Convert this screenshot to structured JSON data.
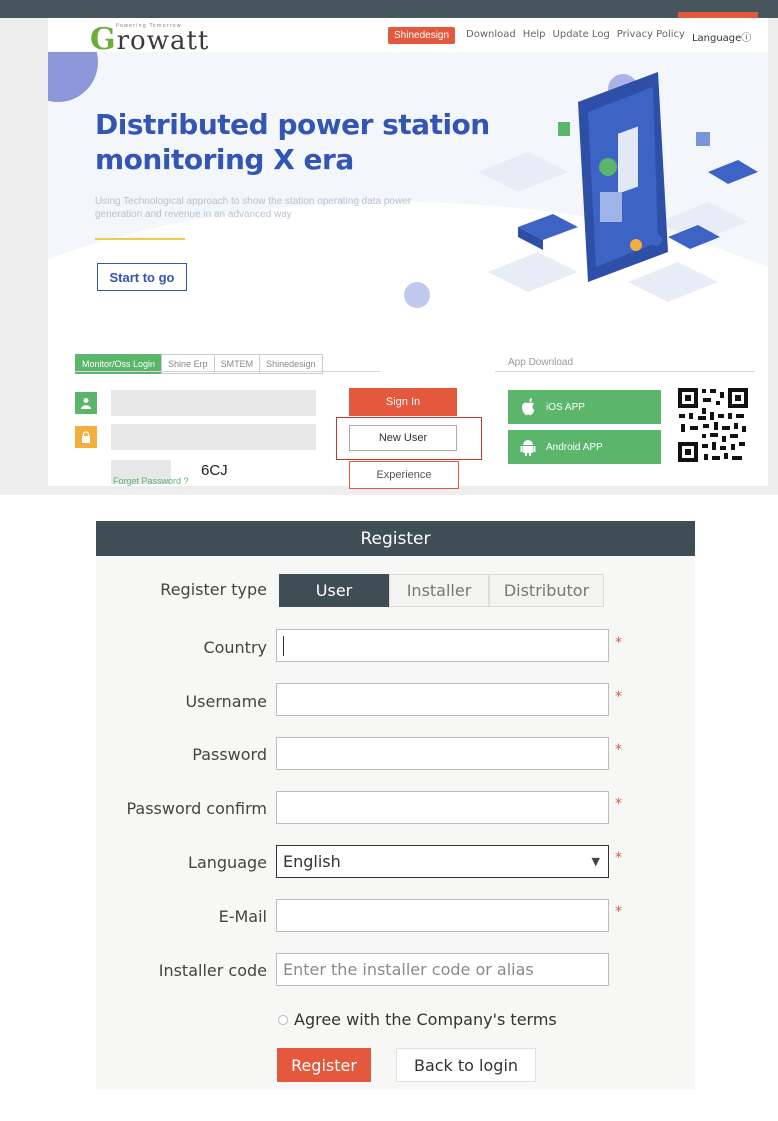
{
  "header": {
    "logo_text": "rowatt",
    "logo_letter": "G",
    "logo_tagline": "Powering Tomorrow",
    "badge": "Shinedesign",
    "links": [
      "Download",
      "Help",
      "Update Log",
      "Privacy Policy"
    ],
    "language": "Languageⓘ"
  },
  "hero": {
    "title": "Distributed power station monitoring X era",
    "subtitle": "Using Technological approach to show the station operating data power generation and revenue in an advanced way",
    "start_button": "Start to go"
  },
  "login": {
    "tabs": [
      "Monitor/Oss Login",
      "Shine Erp",
      "SMTEM",
      "Shinedesign"
    ],
    "active_tab": 0,
    "captcha": "6CJ",
    "forget_password": "Forget Password ?",
    "sign_in": "Sign In",
    "new_user": "New User",
    "experience": "Experience"
  },
  "app_download": {
    "title": "App Download",
    "ios": "iOS APP",
    "android": "Android APP"
  },
  "register": {
    "title": "Register",
    "type_label": "Register type",
    "types": [
      "User",
      "Installer",
      "Distributor"
    ],
    "active_type": 0,
    "fields": {
      "country": {
        "label": "Country",
        "value": ""
      },
      "username": {
        "label": "Username",
        "value": ""
      },
      "password": {
        "label": "Password",
        "value": ""
      },
      "password_confirm": {
        "label": "Password confirm",
        "value": ""
      },
      "language": {
        "label": "Language",
        "value": "English"
      },
      "email": {
        "label": "E-Mail",
        "value": ""
      },
      "installer_code": {
        "label": "Installer code",
        "placeholder": "Enter the installer code or alias"
      }
    },
    "required_mark": "*",
    "agree": "Agree with the Company's terms",
    "register_button": "Register",
    "back_button": "Back to login"
  },
  "colors": {
    "primary_green": "#5bb56b",
    "accent_red": "#e4583d",
    "dark_header": "#3f4d55",
    "hero_blue": "#3355b4"
  }
}
